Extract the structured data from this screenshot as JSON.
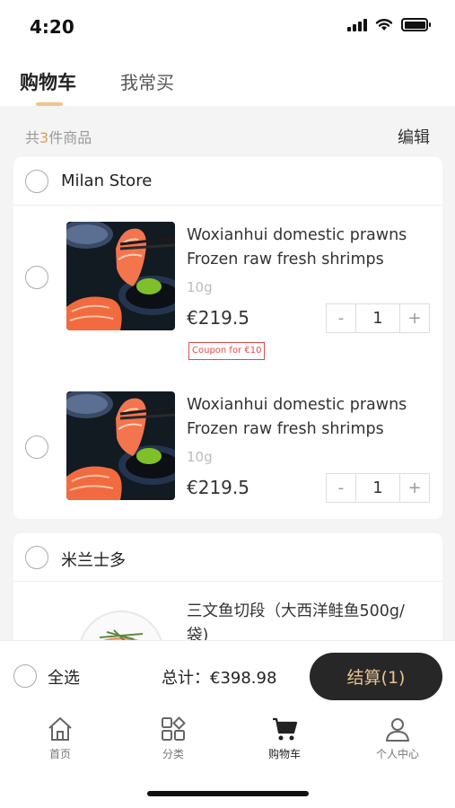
{
  "status_bar": {
    "time": "4:20"
  },
  "tabs": {
    "active": "购物车",
    "inactive": "我常买"
  },
  "summary": {
    "prefix": "共",
    "count": "3",
    "suffix": "件商品",
    "edit_label": "编辑"
  },
  "stores": [
    {
      "name": "Milan Store",
      "items": [
        {
          "title_line1": "Woxianhui domestic prawns",
          "title_line2": "Frozen raw fresh shrimps",
          "spec": "10g",
          "price": "€219.5",
          "coupon": "Coupon for €10",
          "quantity": "1"
        },
        {
          "title_line1": "Woxianhui domestic prawns",
          "title_line2": "Frozen raw fresh shrimps",
          "spec": "10g",
          "price": "€219.5",
          "quantity": "1"
        }
      ]
    },
    {
      "name": "米兰士多",
      "items": [
        {
          "title_line1": "三文鱼切段（大西洋鲑鱼500g/",
          "title_line2": "袋)"
        }
      ]
    }
  ],
  "stepper": {
    "minus": "-",
    "plus": "+"
  },
  "checkout": {
    "select_all": "全选",
    "total": "总计：€398.98",
    "button": "结算(1)"
  },
  "tabbar": [
    {
      "label": "首页",
      "icon": "home-icon"
    },
    {
      "label": "分类",
      "icon": "category-icon"
    },
    {
      "label": "购物车",
      "icon": "cart-icon"
    },
    {
      "label": "个人中心",
      "icon": "user-icon"
    }
  ],
  "colors": {
    "accent_gold": "#e9c38d",
    "count_gold": "#d8a15c",
    "checkout_bg": "#272727",
    "coupon_red": "#e24a4a"
  }
}
